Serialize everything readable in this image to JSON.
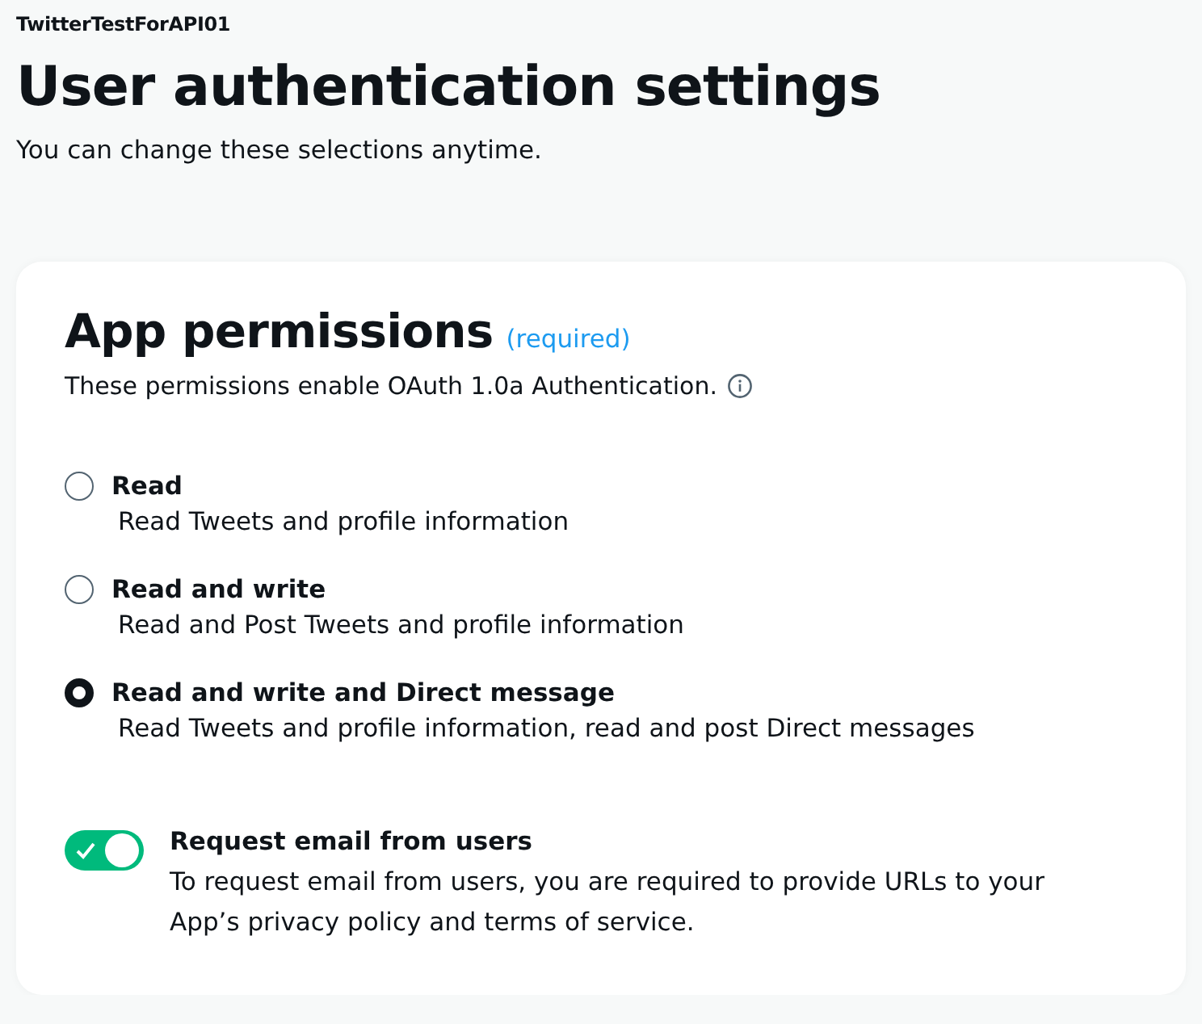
{
  "app_name": "TwitterTestForAPI01",
  "title": "User authentication settings",
  "subtitle": "You can change these selections anytime.",
  "card": {
    "heading": "App permissions",
    "required_note": "(required)",
    "description": "These permissions enable OAuth 1.0a Authentication.",
    "options": [
      {
        "label": "Read",
        "description": "Read Tweets and profile information",
        "selected": false
      },
      {
        "label": "Read and write",
        "description": "Read and Post Tweets and profile information",
        "selected": false
      },
      {
        "label": "Read and write and Direct message",
        "description": "Read Tweets and profile information, read and post Direct messages",
        "selected": true
      }
    ],
    "email_toggle": {
      "label": "Request email from users",
      "description": "To request email from users, you are required to provide URLs to your App’s privacy policy and terms of service.",
      "on": true
    }
  }
}
